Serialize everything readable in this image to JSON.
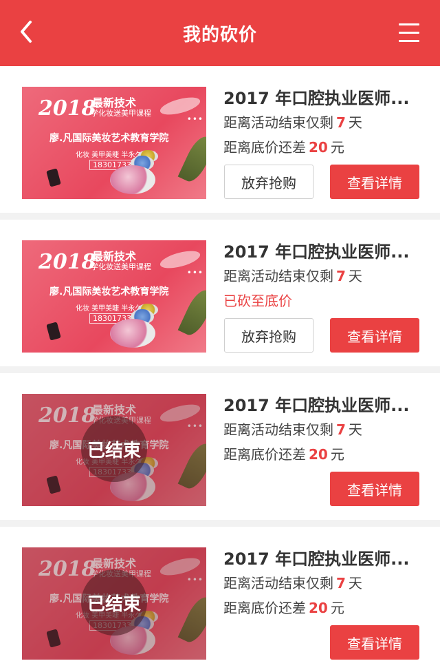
{
  "header": {
    "title": "我的砍价"
  },
  "thumbnail": {
    "year": "2018",
    "line1": "最新技术",
    "line2": "学化妆送美甲课程",
    "line3": "廖.凡国际美妆艺术教育学院",
    "line4": "化妆 美甲美睫 半永久培训",
    "phone": "18301733053",
    "ended_label": "已结束"
  },
  "colors": {
    "accent": "#ea4142"
  },
  "cards": [
    {
      "name": "2017 年口腔执业医师...",
      "end_prefix": "距离活动结束仅剩",
      "end_days": "7",
      "end_unit": "天",
      "diff_prefix": "距离底价还差",
      "diff_amount": "20",
      "diff_unit": "元",
      "give_up": "放弃抢购",
      "details": "查看详情",
      "ended": false
    },
    {
      "name": "2017 年口腔执业医师...",
      "end_prefix": "距离活动结束仅剩",
      "end_days": "7",
      "end_unit": "天",
      "status": "已砍至底价",
      "give_up": "放弃抢购",
      "details": "查看详情",
      "ended": false
    },
    {
      "name": "2017 年口腔执业医师...",
      "end_prefix": "距离活动结束仅剩",
      "end_days": "7",
      "end_unit": "天",
      "diff_prefix": "距离底价还差",
      "diff_amount": "20",
      "diff_unit": "元",
      "details": "查看详情",
      "ended": true
    },
    {
      "name": "2017 年口腔执业医师...",
      "end_prefix": "距离活动结束仅剩",
      "end_days": "7",
      "end_unit": "天",
      "diff_prefix": "距离底价还差",
      "diff_amount": "20",
      "diff_unit": "元",
      "details": "查看详情",
      "ended": true
    }
  ]
}
